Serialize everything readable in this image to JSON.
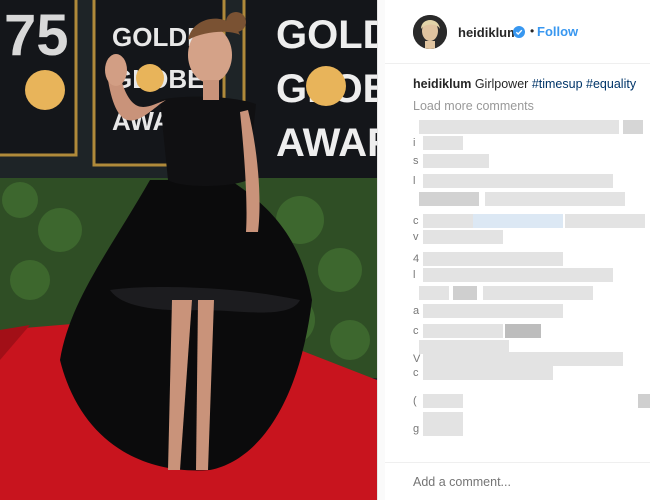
{
  "post": {
    "photo_alt": "",
    "sign_lines": [
      "GOLDEN",
      "GLOBE",
      "AWARDS"
    ],
    "sign_number": "75"
  },
  "header": {
    "username": "heidiklum",
    "separator": "•",
    "follow_label": "Follow"
  },
  "caption": {
    "username": "heidiklum",
    "text": "Girlpower",
    "hashtags": [
      "#timesup",
      "#equality"
    ]
  },
  "comments": {
    "load_more_label": "Load more comments",
    "leading_chars": [
      "i",
      "s",
      "l",
      "c",
      "c",
      "v",
      "4",
      "l",
      "a",
      "c",
      "V",
      "c",
      "(",
      "g"
    ]
  },
  "comment_box": {
    "placeholder": "Add a comment..."
  },
  "colors": {
    "link_blue": "#3897f0",
    "hashtag_blue": "#003569",
    "carpet_red": "#c8141e"
  }
}
